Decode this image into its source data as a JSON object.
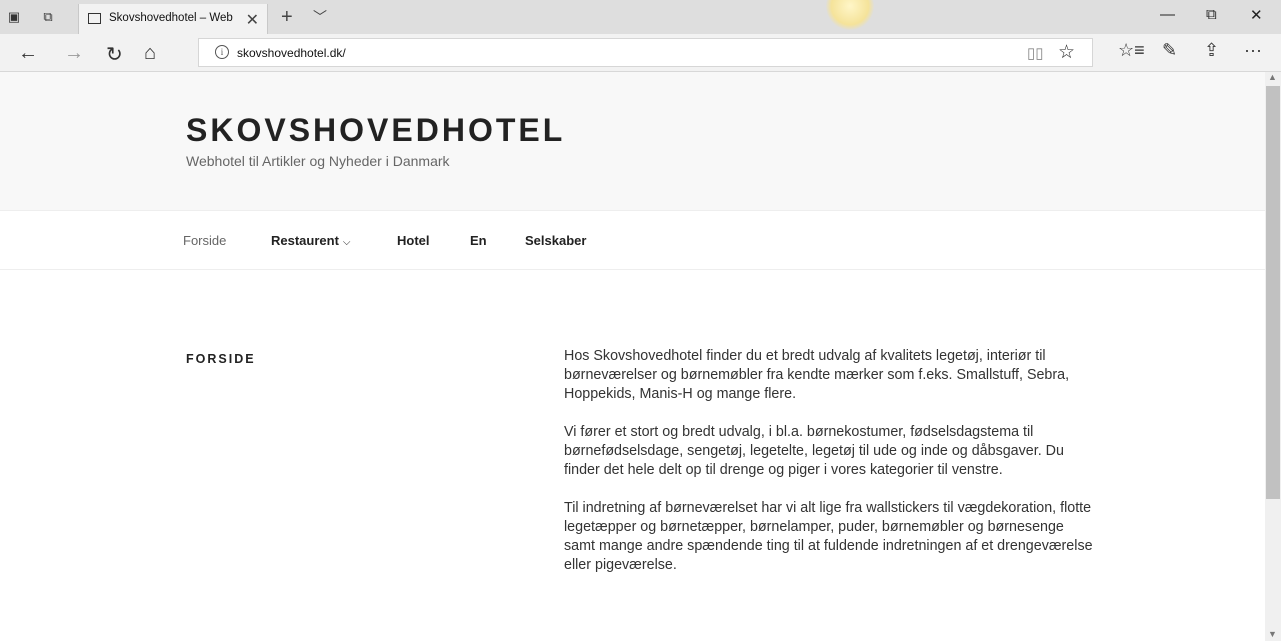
{
  "browser": {
    "tab_title": "Skovshovedhotel – Web",
    "url": "skovshovedhotel.dk/",
    "new_tab_symbol": "+",
    "tab_menu_symbol": "﹀",
    "close_tab_symbol": "✕",
    "win_minimize": "—",
    "win_restore": "⧉",
    "win_close": "✕",
    "more_symbol": "···"
  },
  "site": {
    "title": "SKOVSHOVEDHOTEL",
    "description": "Webhotel til Artikler og Nyheder i Danmark"
  },
  "nav": {
    "items": [
      {
        "label": "Forside",
        "current": true
      },
      {
        "label": "Restaurent",
        "has_dropdown": true
      },
      {
        "label": "Hotel"
      },
      {
        "label": "En"
      },
      {
        "label": "Selskaber"
      }
    ],
    "dropdown_symbol": "⌵"
  },
  "page": {
    "heading": "FORSIDE",
    "paragraphs": [
      "Hos Skovshovedhotel finder du et bredt udvalg af kvalitets legetøj, interiør til børneværelser og børnemøbler fra kendte mærker som f.eks. Smallstuff, Sebra, Hoppekids, Manis-H og mange flere.",
      "Vi fører et stort og bredt udvalg, i bl.a. børnekostumer, fødselsdagstema til børnefødselsdage, sengetøj, legetelte, legetøj til ude og inde og dåbsgaver. Du finder det hele delt op til drenge og piger i vores kategorier til venstre.",
      "Til indretning af børneværelset har vi alt lige fra wallstickers til vægdekoration, flotte legetæpper og børnetæpper, børnelamper, puder, børnemøbler og børnesenge samt mange andre spændende ting til at fuldende indretningen af et drengeværelse eller pigeværelse."
    ]
  },
  "colors": {
    "header_bg": "#f8f8f8",
    "text": "#333333",
    "chrome_bg": "#dedede"
  }
}
